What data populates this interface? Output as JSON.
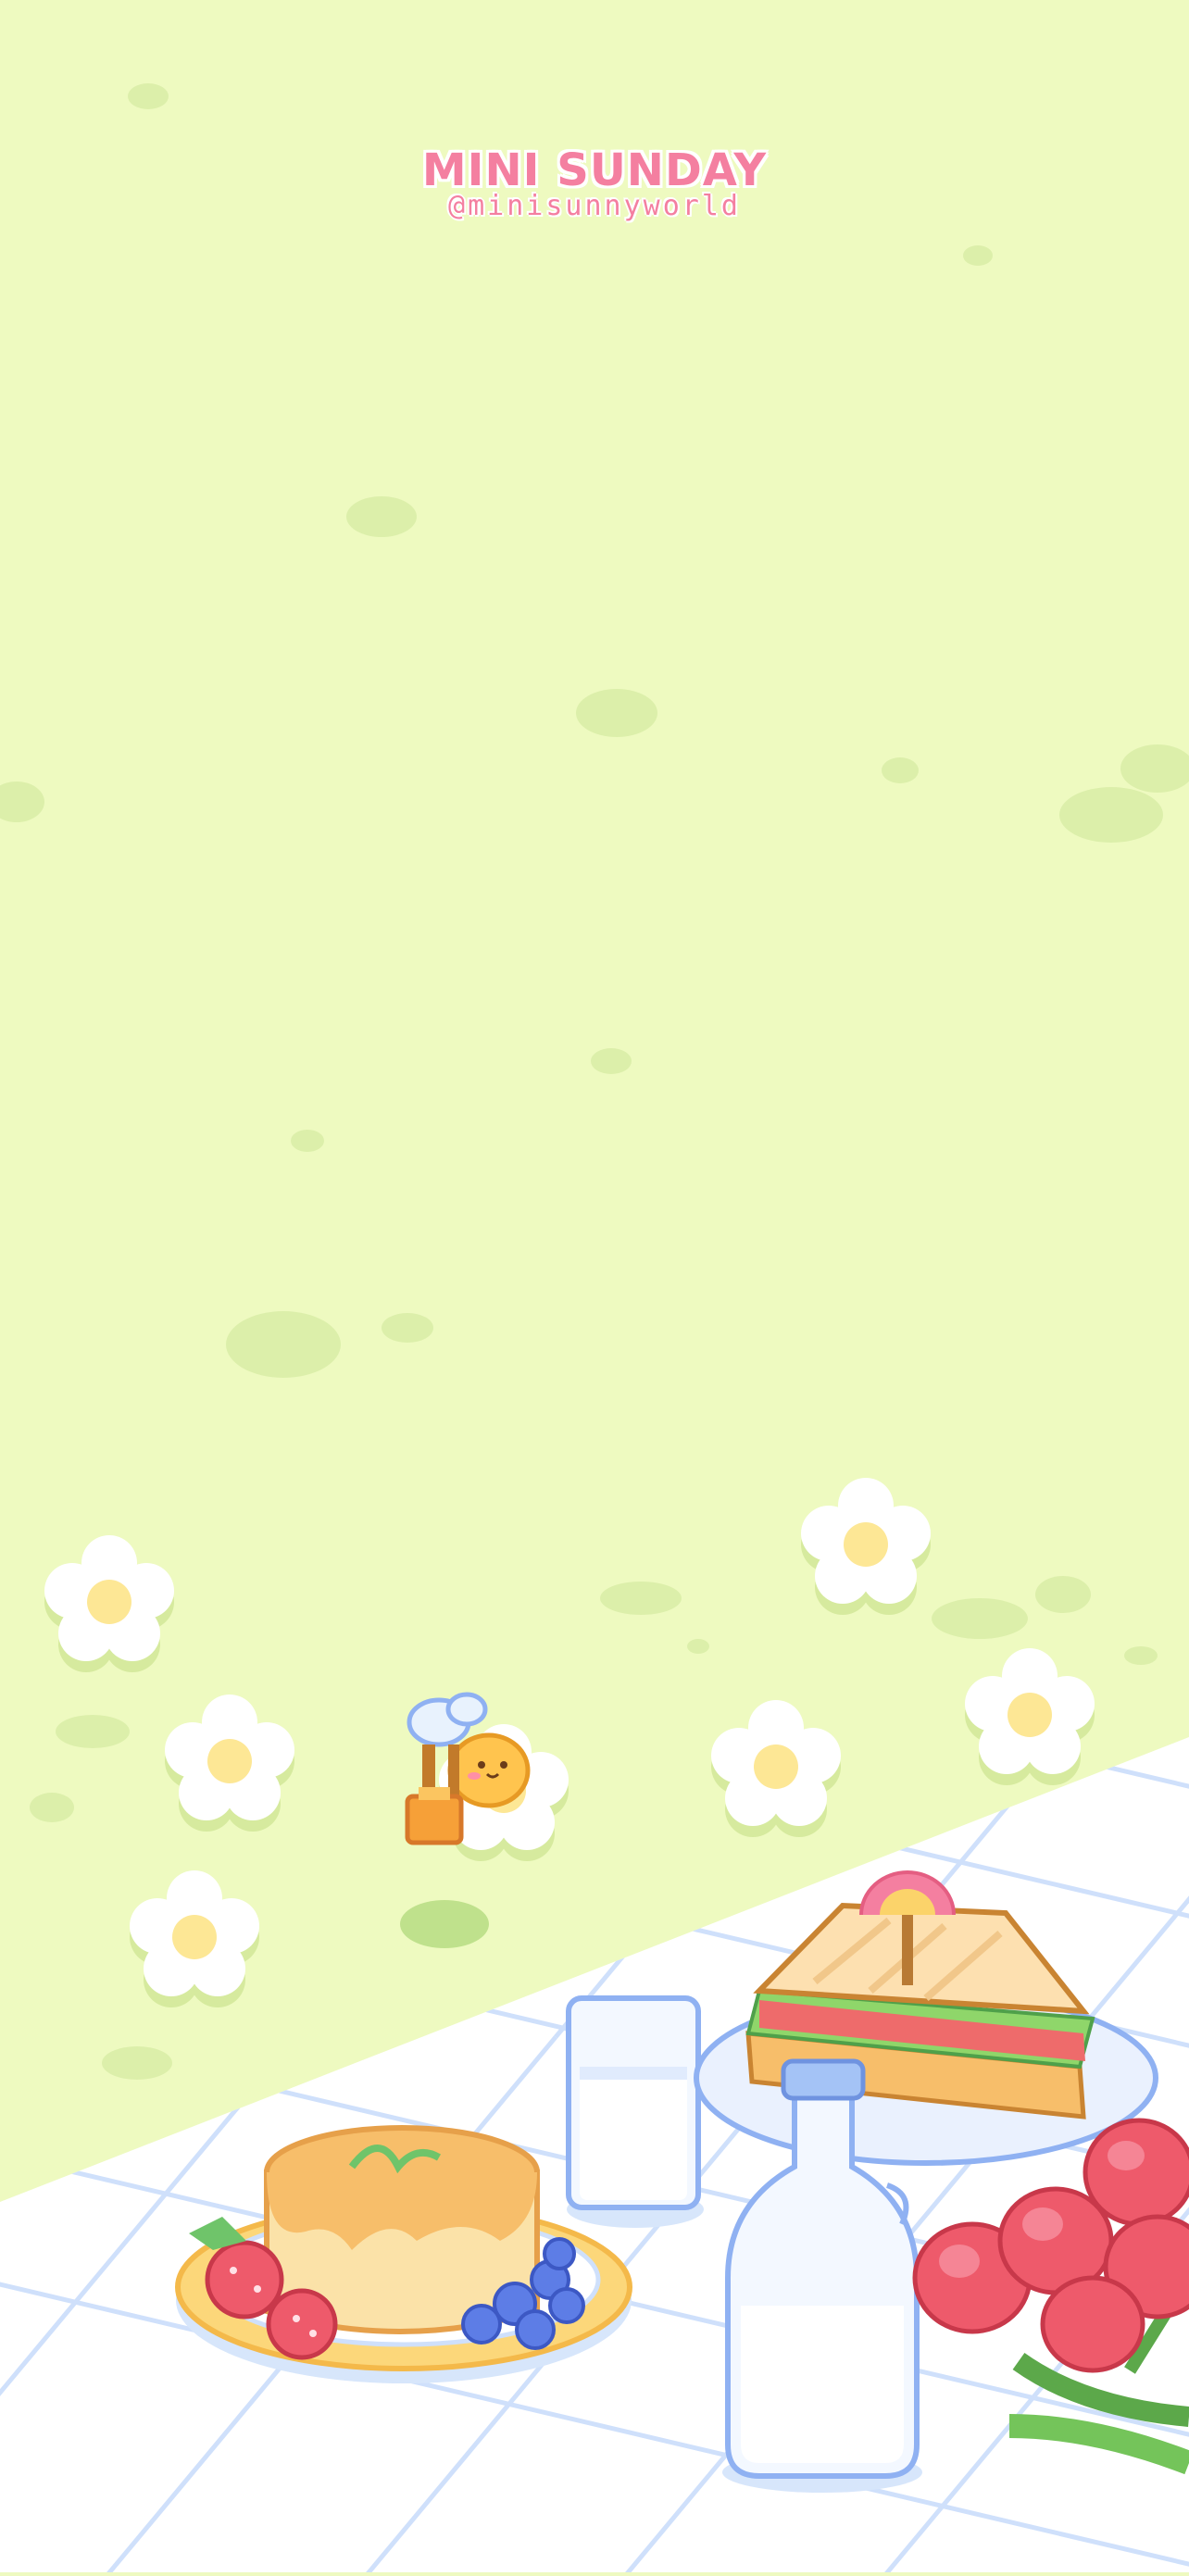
{
  "watermark": {
    "title": "MINI SUNDAY",
    "handle": "@minisunnyworld"
  },
  "scene": {
    "description_icons": [
      "grass-field",
      "daisy-flower",
      "bee-icon",
      "honey-pot-icon",
      "pudding-plate",
      "sandwich-plate",
      "milk-glass",
      "milk-bottle",
      "tulip-bouquet",
      "picnic-blanket"
    ]
  },
  "colors": {
    "grass": "#eefac0",
    "grass_spot": "#d9eea8",
    "blanket": "#ffffff",
    "blanket_grid": "#cfe0fb",
    "accent_pink": "#f47fa0",
    "pudding": "#f7be6a",
    "tulip": "#ee5a6b"
  }
}
